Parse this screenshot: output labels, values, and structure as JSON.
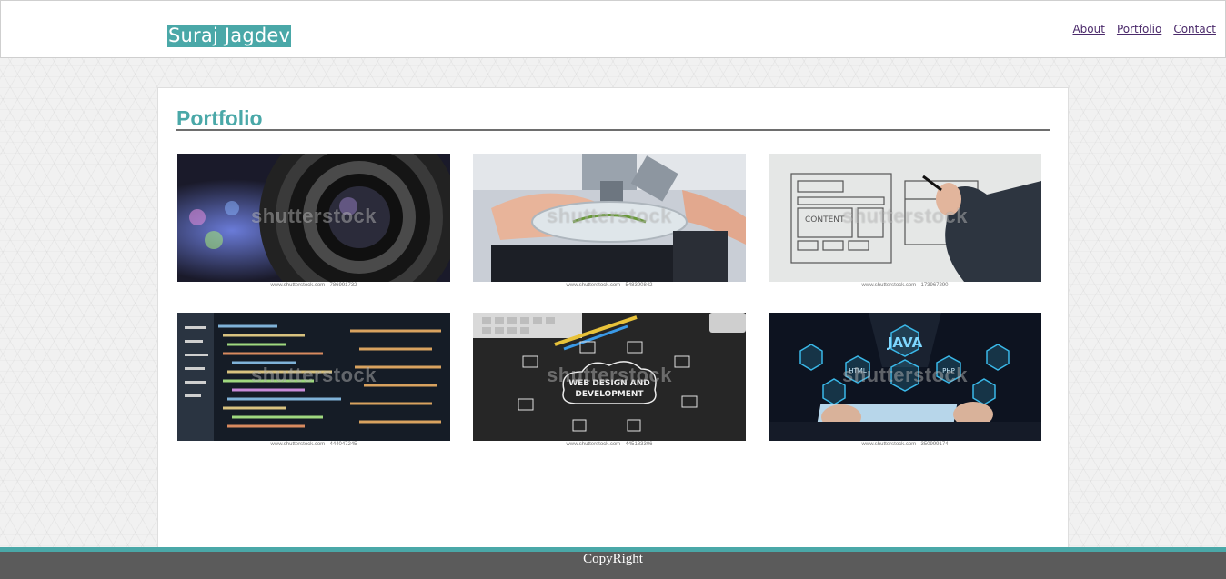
{
  "header": {
    "brand": "Suraj Jagdev",
    "nav": [
      {
        "label": "About"
      },
      {
        "label": "Portfolio"
      },
      {
        "label": "Contact"
      }
    ]
  },
  "main": {
    "title": "Portfolio",
    "gallery": [
      {
        "subject": "camera lens",
        "watermark": "shutterstock",
        "credit": "www.shutterstock.com · 786991732"
      },
      {
        "subject": "microscope with petri dish",
        "watermark": "shutterstock",
        "credit": "www.shutterstock.com · 548390842"
      },
      {
        "subject": "hand sketching website wireframe",
        "watermark": "shutterstock",
        "credit": "www.shutterstock.com · 173967290"
      },
      {
        "subject": "source code on screen",
        "watermark": "shutterstock",
        "credit": "www.shutterstock.com · 444047245"
      },
      {
        "subject": "web design and development chalkboard",
        "watermark": "shutterstock",
        "credit": "www.shutterstock.com · 445183306"
      },
      {
        "subject": "java technologies hexagons on tablet",
        "watermark": "shutterstock",
        "credit": "www.shutterstock.com · 350999174"
      }
    ],
    "chalk_text": {
      "line1": "WEB DESIGN AND",
      "line2": "DEVELOPMENT",
      "java": "JAVA",
      "html": "HTML",
      "php": "PHP",
      "content": "CONTENT"
    }
  },
  "footer": {
    "text": "CopyRight"
  },
  "colors": {
    "accent": "#4aa8a8",
    "footer_bg": "#5b5b5b",
    "link": "#4b2a6b"
  }
}
